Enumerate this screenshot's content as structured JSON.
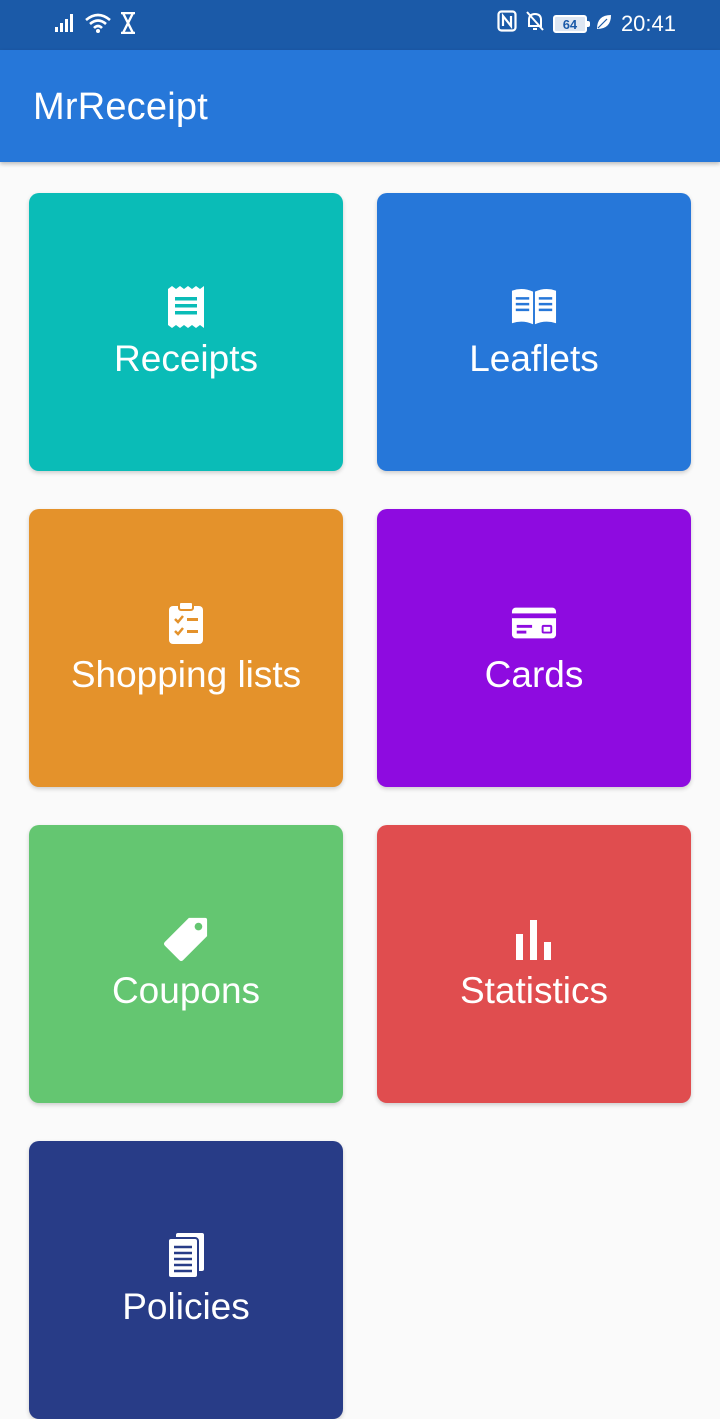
{
  "status_bar": {
    "battery_level": "64",
    "time": "20:41"
  },
  "app": {
    "title": "MrReceipt"
  },
  "tiles": [
    {
      "label": "Receipts",
      "icon": "receipt-icon",
      "color": "#0abcb7"
    },
    {
      "label": "Leaflets",
      "icon": "book-icon",
      "color": "#2677d9"
    },
    {
      "label": "Shopping lists",
      "icon": "clipboard-check-icon",
      "color": "#e4922b"
    },
    {
      "label": "Cards",
      "icon": "credit-card-icon",
      "color": "#8e0be0"
    },
    {
      "label": "Coupons",
      "icon": "tag-icon",
      "color": "#64c671"
    },
    {
      "label": "Statistics",
      "icon": "bar-chart-icon",
      "color": "#e04d4f"
    },
    {
      "label": "Policies",
      "icon": "documents-icon",
      "color": "#283c87"
    }
  ]
}
